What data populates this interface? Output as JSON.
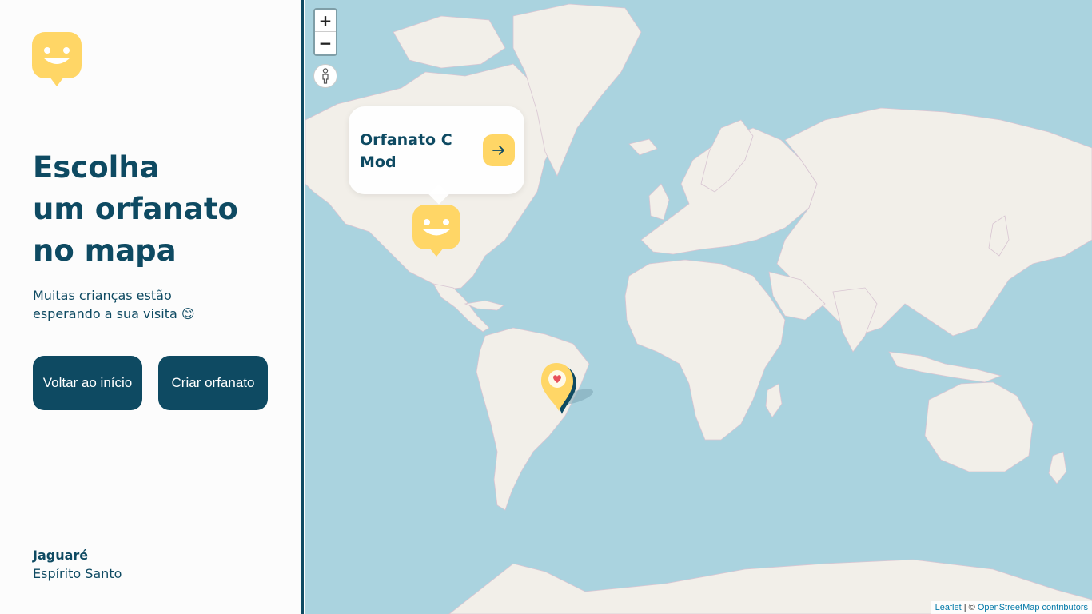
{
  "sidebar": {
    "headline": [
      "Escolha",
      "um orfanato",
      "no mapa"
    ],
    "subtitle": [
      "Muitas crianças estão",
      "esperando a sua visita 😊"
    ],
    "buttons": {
      "home": "Voltar ao início",
      "create": "Criar orfanato"
    },
    "location": {
      "city": "Jaguaré",
      "state": "Espírito Santo"
    }
  },
  "map": {
    "zoom_in": "+",
    "zoom_out": "−",
    "popup": {
      "name_lines": [
        "Orfanato C",
        "Mod"
      ],
      "arrow": "→"
    },
    "attribution": {
      "leaflet": "Leaflet",
      "separator": " | © ",
      "osm": "OpenStreetMap contributors"
    }
  },
  "colors": {
    "primary": "#0e4a62",
    "accent": "#ffd666",
    "ocean": "#aad3df",
    "land": "#f2efe9"
  },
  "icons": [
    "smile-logo-icon",
    "zoom-in-icon",
    "zoom-out-icon",
    "pegman-icon",
    "arrow-right-icon",
    "orphanage-marker-icon",
    "location-pin-icon"
  ]
}
